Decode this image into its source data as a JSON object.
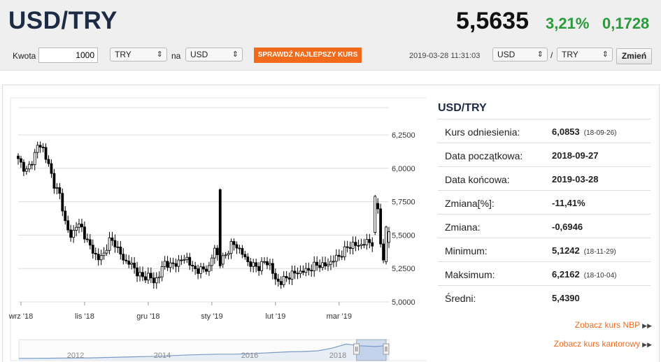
{
  "header": {
    "pair": "USD/TRY",
    "rate": "5,5635",
    "change_pct": "3,21%",
    "change_abs": "0,1728"
  },
  "converter": {
    "amount_label": "Kwota",
    "amount_value": "1000",
    "from_currency": "TRY",
    "to_label": "na",
    "to_currency": "USD",
    "check_button": "SPRAWDŹ NAJLEPSZY KURS",
    "timestamp": "2019-03-28 11:31:03",
    "pair_base": "USD",
    "pair_separator": "/",
    "pair_quote": "TRY",
    "change_button": "Zmień"
  },
  "info": {
    "title": "USD/TRY",
    "rows": [
      {
        "label": "Kurs odniesienia:",
        "value": "6,0853",
        "date": "(18-09-26)"
      },
      {
        "label": "Data początkowa:",
        "value": "2018-09-27",
        "date": ""
      },
      {
        "label": "Data końcowa:",
        "value": "2019-03-28",
        "date": ""
      },
      {
        "label": "Zmiana[%]:",
        "value": "-11,41%",
        "date": ""
      },
      {
        "label": "Zmiana:",
        "value": "-0,6946",
        "date": ""
      },
      {
        "label": "Minimum:",
        "value": "5,1242",
        "date": "(18-11-29)"
      },
      {
        "label": "Maksimum:",
        "value": "6,2162",
        "date": "(18-10-04)"
      },
      {
        "label": "Średni:",
        "value": "5,4390",
        "date": ""
      }
    ],
    "link_nbp": "Zobacz kurs NBP",
    "link_kantor": "Zobacz kurs kantorowy"
  },
  "colors": {
    "accent_orange": "#f26a1b",
    "positive_green": "#2a9a3b",
    "title_navy": "#1d2b45",
    "navigator_line": "#7a9cc6"
  },
  "chart_data": {
    "type": "candlestick",
    "y_ticks": [
      "6,2500",
      "6,0000",
      "5,7500",
      "5,5000",
      "5,2500",
      "5,0000"
    ],
    "y_tick_values": [
      6.25,
      6.0,
      5.75,
      5.5,
      5.25,
      5.0
    ],
    "ylim": [
      5.0,
      6.3
    ],
    "x_ticks": [
      "wrz '18",
      "lis '18",
      "gru '18",
      "sty '19",
      "lut '19",
      "mar '19"
    ],
    "x_tick_index": [
      1,
      24,
      47,
      70,
      93,
      116
    ],
    "n_points": 135,
    "anchors": [
      [
        0,
        6.06
      ],
      [
        3,
        5.98
      ],
      [
        5,
        6.05
      ],
      [
        7,
        6.17
      ],
      [
        9,
        6.15
      ],
      [
        11,
        6.02
      ],
      [
        13,
        5.88
      ],
      [
        15,
        5.8
      ],
      [
        17,
        5.6
      ],
      [
        19,
        5.48
      ],
      [
        21,
        5.58
      ],
      [
        23,
        5.55
      ],
      [
        25,
        5.45
      ],
      [
        27,
        5.38
      ],
      [
        29,
        5.32
      ],
      [
        31,
        5.36
      ],
      [
        33,
        5.46
      ],
      [
        35,
        5.44
      ],
      [
        37,
        5.35
      ],
      [
        39,
        5.3
      ],
      [
        41,
        5.28
      ],
      [
        43,
        5.22
      ],
      [
        45,
        5.18
      ],
      [
        47,
        5.2
      ],
      [
        49,
        5.15
      ],
      [
        51,
        5.2
      ],
      [
        53,
        5.3
      ],
      [
        55,
        5.27
      ],
      [
        57,
        5.29
      ],
      [
        59,
        5.31
      ],
      [
        61,
        5.33
      ],
      [
        63,
        5.25
      ],
      [
        65,
        5.24
      ],
      [
        67,
        5.24
      ],
      [
        69,
        5.26
      ],
      [
        71,
        5.4
      ],
      [
        73,
        5.3
      ],
      [
        75,
        5.35
      ],
      [
        77,
        5.43
      ],
      [
        79,
        5.42
      ],
      [
        81,
        5.36
      ],
      [
        83,
        5.3
      ],
      [
        85,
        5.27
      ],
      [
        87,
        5.26
      ],
      [
        89,
        5.3
      ],
      [
        91,
        5.28
      ],
      [
        93,
        5.16
      ],
      [
        95,
        5.15
      ],
      [
        97,
        5.18
      ],
      [
        99,
        5.21
      ],
      [
        101,
        5.22
      ],
      [
        103,
        5.23
      ],
      [
        105,
        5.24
      ],
      [
        107,
        5.27
      ],
      [
        109,
        5.28
      ],
      [
        111,
        5.27
      ],
      [
        113,
        5.3
      ],
      [
        115,
        5.33
      ],
      [
        117,
        5.36
      ],
      [
        119,
        5.41
      ],
      [
        121,
        5.43
      ],
      [
        123,
        5.42
      ],
      [
        125,
        5.44
      ],
      [
        127,
        5.45
      ],
      [
        128,
        5.44
      ],
      [
        129,
        5.71
      ],
      [
        130,
        5.7
      ],
      [
        131,
        5.45
      ],
      [
        132,
        5.3
      ],
      [
        133,
        5.45
      ],
      [
        134,
        5.52
      ]
    ],
    "spikes": [
      [
        73,
        5.85,
        5.25
      ],
      [
        129,
        5.8,
        5.5
      ],
      [
        133,
        5.57,
        5.28
      ]
    ],
    "navigator": {
      "labels": [
        "2012",
        "2014",
        "2016",
        "2018"
      ],
      "series": [
        1.75,
        1.78,
        1.8,
        1.83,
        1.85,
        1.9,
        2.0,
        2.1,
        2.2,
        2.3,
        2.4,
        2.6,
        2.8,
        2.9,
        3.0,
        3.0,
        3.1,
        3.3,
        3.5,
        3.7,
        3.8,
        4.0,
        4.8,
        6.0,
        5.5,
        5.3,
        5.6
      ],
      "selection": [
        0.92,
        1.0
      ]
    }
  }
}
